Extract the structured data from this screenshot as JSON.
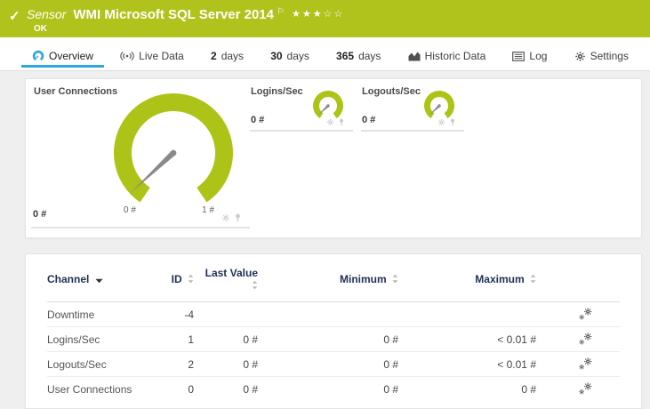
{
  "colors": {
    "accent_green": "#afc31c",
    "accent_blue": "#2ea6e0",
    "table_header_text": "#1e3056"
  },
  "icons": {
    "check": "✓",
    "flag": "⚐"
  },
  "sensor_header": {
    "type_label": "Sensor",
    "title": "WMI Microsoft SQL Server 2014",
    "status": "OK",
    "rating": {
      "filled": 3,
      "total": 5,
      "stars": "★★★☆☆"
    }
  },
  "tabs": [
    {
      "label": "Overview",
      "active": true
    },
    {
      "label": "Live Data"
    },
    {
      "number": "2",
      "label": "days"
    },
    {
      "number": "30",
      "label": "days"
    },
    {
      "number": "365",
      "label": "days"
    },
    {
      "label": "Historic Data"
    },
    {
      "label": "Log"
    },
    {
      "label": "Settings"
    }
  ],
  "gauges": {
    "main": {
      "title": "User Connections",
      "value": "0 #",
      "scale_min": "0 #",
      "scale_max": "1 #"
    },
    "mini": [
      {
        "title": "Logins/Sec",
        "value": "0 #"
      },
      {
        "title": "Logouts/Sec",
        "value": "0 #"
      }
    ]
  },
  "table": {
    "columns": {
      "channel": "Channel",
      "id": "ID",
      "last": "Last Value",
      "min": "Minimum",
      "max": "Maximum"
    },
    "rows": [
      {
        "channel": "Downtime",
        "id": "-4",
        "last": "",
        "min": "",
        "max": ""
      },
      {
        "channel": "Logins/Sec",
        "id": "1",
        "last": "0 #",
        "min": "0 #",
        "max": "< 0.01 #"
      },
      {
        "channel": "Logouts/Sec",
        "id": "2",
        "last": "0 #",
        "min": "0 #",
        "max": "< 0.01 #"
      },
      {
        "channel": "User Connections",
        "id": "0",
        "last": "0 #",
        "min": "0 #",
        "max": "0 #"
      }
    ]
  }
}
